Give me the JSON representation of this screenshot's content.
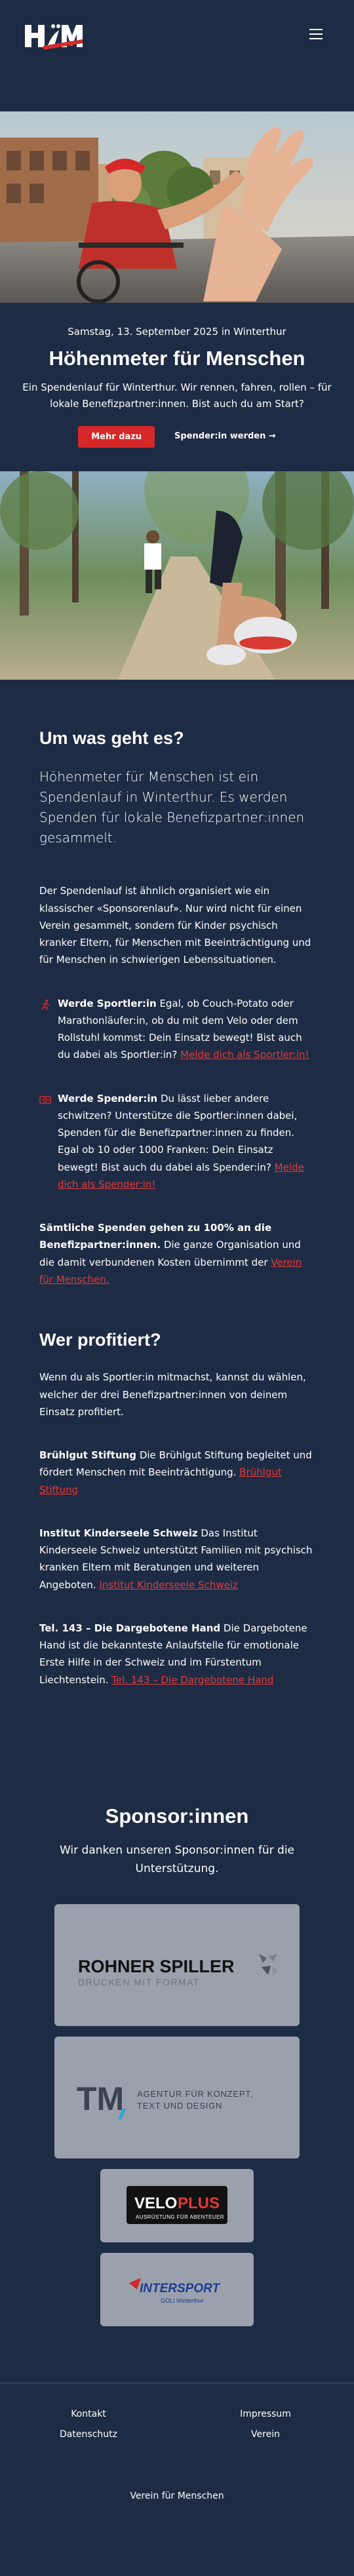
{
  "header": {
    "logo_text": "HöM",
    "menu_icon": "hamburger-menu-icon"
  },
  "intro": {
    "date": "Samstag, 13. September 2025 in Winterthur",
    "title": "Höhenmeter für Menschen",
    "text": "Ein Spendenlauf für Winterthur. Wir rennen, fahren, rollen – für lokale Benefizpartner:innen. Bist auch du am Start?",
    "button_primary": "Mehr dazu",
    "button_secondary": "Spender:in werden →"
  },
  "about": {
    "title": "Um was geht es?",
    "lead": "Höhenmeter für Menschen ist ein Spendenlauf in Winterthur. Es werden Spenden für lokale Benefizpartner:innen gesammelt.",
    "para": "Der Spendenlauf ist ähnlich organisiert wie ein klassischer «Sponsorenlauf». Nur wird nicht für einen Verein gesammelt, sondern für Kinder psychisch kranker Eltern, für Menschen mit Beeinträchtigung und für Menschen in schwierigen Lebenssituationen.",
    "feature1": {
      "icon": "running-icon",
      "strong": "Werde Sportler:in",
      "text": " Egal, ob Couch-Potato oder Marathonläufer:in, ob du mit dem Velo oder dem Rollstuhl kommst: Dein Einsatz bewegt! Bist auch du dabei als Sportler:in? ",
      "link": "Melde dich als Sportler:in!"
    },
    "feature2": {
      "icon": "money-icon",
      "strong": "Werde Spender:in",
      "text": " Du lässt lieber andere schwitzen? Unterstütze die Sportler:innen dabei, Spenden für die Benefizpartner:innen zu finden. Egal ob 10 oder 1000 Franken: Dein Einsatz bewegt! Bist auch du dabei als Spender:in? ",
      "link": "Melde dich als Spender:in!"
    },
    "donations": {
      "strong": "Sämtliche Spenden gehen zu 100% an die Benefizpartner:innen.",
      "text": " Die ganze Organisation und die damit verbundenen Kosten übernimmt der ",
      "link": "Verein für Menschen."
    }
  },
  "beneficiaries": {
    "title": "Wer profitiert?",
    "intro": "Wenn du als Sportler:in mitmachst, kannst du wählen, welcher der drei Benefizpartner:innen von deinem Einsatz profitiert.",
    "items": [
      {
        "strong": "Brühlgut Stiftung",
        "text": " Die Brühlgut Stiftung begleitet und fördert Menschen mit Beeinträchtigung. ",
        "link": "Brühlgut Stiftung"
      },
      {
        "strong": "Institut Kinderseele Schweiz",
        "text": " Das Institut Kinderseele Schweiz unterstützt Familien mit psychisch kranken Eltern mit Beratungen und weiteren Angeboten. ",
        "link": "Institut Kinderseele Schweiz"
      },
      {
        "strong": "Tel. 143 – Die Dargebotene Hand",
        "text": " Die Dargebotene Hand ist die bekannteste Anlaufstelle für emotionale Erste Hilfe in der Schweiz und im Fürstentum Liechtenstein. ",
        "link": "Tel. 143 – Die Dargebotene Hand"
      }
    ]
  },
  "sponsors": {
    "title": "Sponsor:innen",
    "subtitle": "Wir danken unseren Sponsor:innen für die Unterstützung.",
    "rohner": {
      "name": "ROHNER SPILLER",
      "tagline": "DRUCKEN MIT FORMAT"
    },
    "tm": {
      "name": "TM",
      "tagline1": "AGENTUR FÜR KONZEPT,",
      "tagline2": "TEXT UND DESIGN"
    },
    "veloplus": {
      "name_a": "VELO",
      "name_b": "PLUS",
      "tagline": "AUSRÜSTUNG FÜR ABENTEUER"
    },
    "intersport": {
      "name": "INTERSPORT",
      "sub": "GOLI Winterthur"
    }
  },
  "footer": {
    "links": [
      "Kontakt",
      "Impressum",
      "Datenschutz",
      "Verein"
    ],
    "bottom": "Verein für Menschen"
  },
  "colors": {
    "background": "#1e2b44",
    "accent": "#d62828",
    "card": "#9aa1ac"
  }
}
